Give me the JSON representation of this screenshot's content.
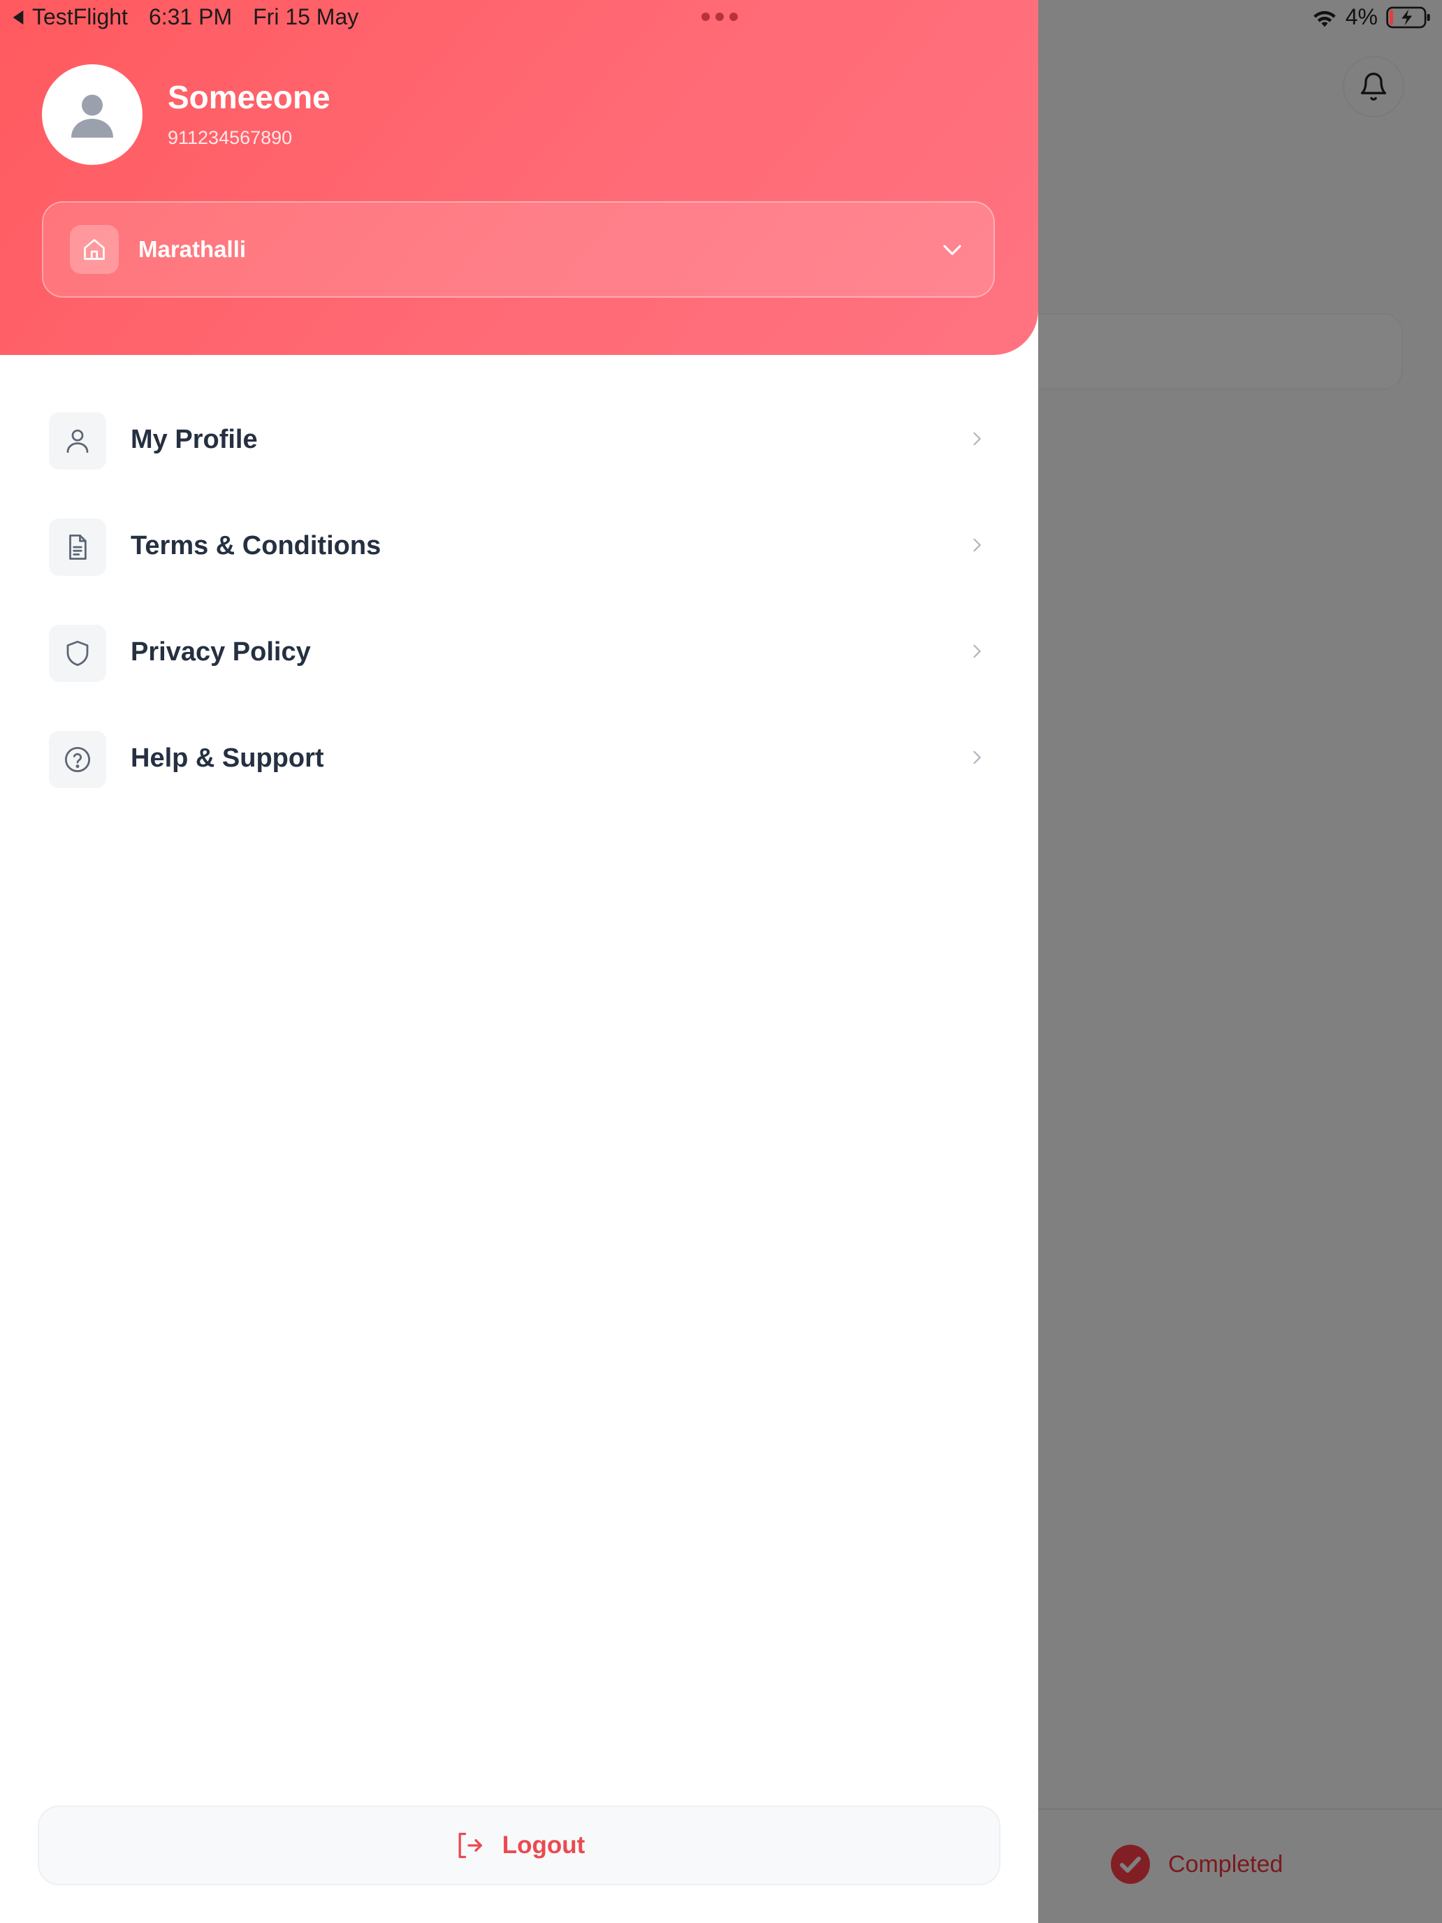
{
  "status_bar": {
    "back_app": "TestFlight",
    "time": "6:31 PM",
    "date": "Fri 15 May",
    "battery": "4%"
  },
  "profile": {
    "name": "Someeone",
    "phone": "911234567890"
  },
  "location": {
    "selected": "Marathalli"
  },
  "menu": {
    "items": [
      {
        "label": "My Profile",
        "icon": "user-icon"
      },
      {
        "label": "Terms & Conditions",
        "icon": "document-icon"
      },
      {
        "label": "Privacy Policy",
        "icon": "shield-icon"
      },
      {
        "label": "Help & Support",
        "icon": "help-circle-icon"
      }
    ]
  },
  "logout": {
    "label": "Logout"
  },
  "background": {
    "status_label": "Completed"
  },
  "colors": {
    "accent": "#ff5a5f",
    "accent_text": "#ea4a4f",
    "menu_text": "#253041"
  }
}
